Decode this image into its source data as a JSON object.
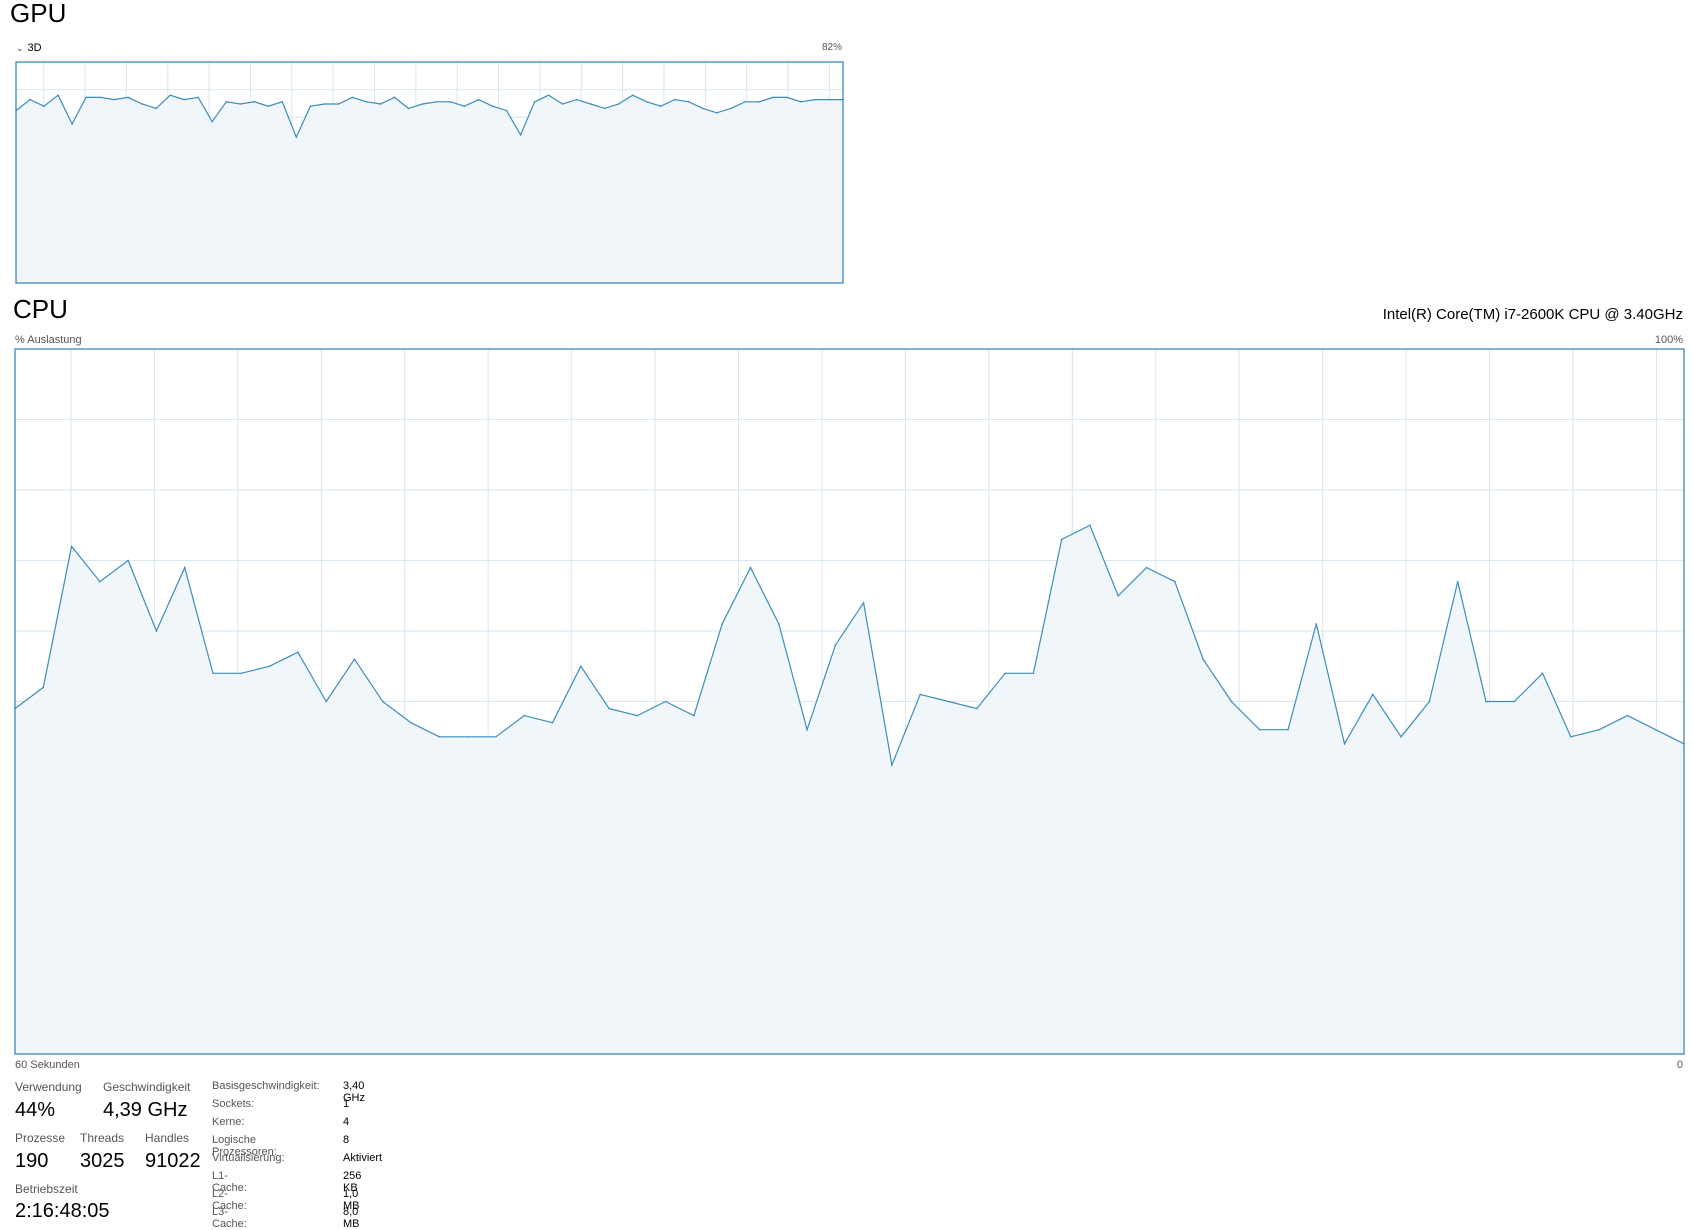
{
  "gpu": {
    "title": "GPU",
    "engine_label": "3D",
    "expand_icon": "chevron-down-icon",
    "max_label": "82%",
    "chart_data": {
      "type": "line",
      "ylim": [
        0,
        100
      ],
      "values": [
        78,
        83,
        80,
        85,
        72,
        84,
        84,
        83,
        84,
        81,
        79,
        85,
        83,
        84,
        73,
        82,
        81,
        82,
        80,
        82,
        66,
        80,
        81,
        81,
        84,
        82,
        81,
        84,
        79,
        81,
        82,
        82,
        80,
        83,
        80,
        78,
        67,
        82,
        85,
        81,
        83,
        81,
        79,
        81,
        85,
        82,
        80,
        83,
        82,
        79,
        77,
        79,
        82,
        82,
        84,
        84,
        82,
        83,
        83,
        83
      ]
    }
  },
  "cpu": {
    "title": "CPU",
    "model": "Intel(R) Core(TM) i7-2600K CPU @ 3.40GHz",
    "y_axis_label": "% Auslastung",
    "y_max_label": "100%",
    "x_left_label": "60 Sekunden",
    "x_right_label": "0",
    "chart_data": {
      "type": "area",
      "ylim": [
        0,
        100
      ],
      "values": [
        49,
        52,
        72,
        67,
        70,
        60,
        69,
        54,
        54,
        55,
        57,
        50,
        56,
        50,
        47,
        45,
        45,
        45,
        48,
        47,
        55,
        49,
        48,
        50,
        48,
        61,
        69,
        61,
        46,
        58,
        64,
        41,
        51,
        50,
        49,
        54,
        54,
        73,
        75,
        65,
        69,
        67,
        56,
        50,
        46,
        46,
        61,
        44,
        51,
        45,
        50,
        67,
        50,
        50,
        54,
        45,
        46,
        48,
        46,
        44
      ]
    }
  },
  "stats": {
    "usage_label": "Verwendung",
    "usage_value": "44%",
    "speed_label": "Geschwindigkeit",
    "speed_value": "4,39 GHz",
    "processes_label": "Prozesse",
    "processes_value": "190",
    "threads_label": "Threads",
    "threads_value": "3025",
    "handles_label": "Handles",
    "handles_value": "91022",
    "uptime_label": "Betriebszeit",
    "uptime_value": "2:16:48:05"
  },
  "specs": [
    {
      "label": "Basisgeschwindigkeit:",
      "value": "3,40 GHz"
    },
    {
      "label": "Sockets:",
      "value": "1"
    },
    {
      "label": "Kerne:",
      "value": "4"
    },
    {
      "label": "Logische Prozessoren:",
      "value": "8"
    },
    {
      "label": "Virtualisierung:",
      "value": "Aktiviert"
    },
    {
      "label": "L1-Cache:",
      "value": "256 KB"
    },
    {
      "label": "L2-Cache:",
      "value": "1,0 MB"
    },
    {
      "label": "L3-Cache:",
      "value": "8,0 MB"
    }
  ],
  "colors": {
    "line": "#3c8dbc",
    "fill": "#f1f6fa",
    "grid": "#d7e6ef",
    "border": "#2e7fb4"
  }
}
